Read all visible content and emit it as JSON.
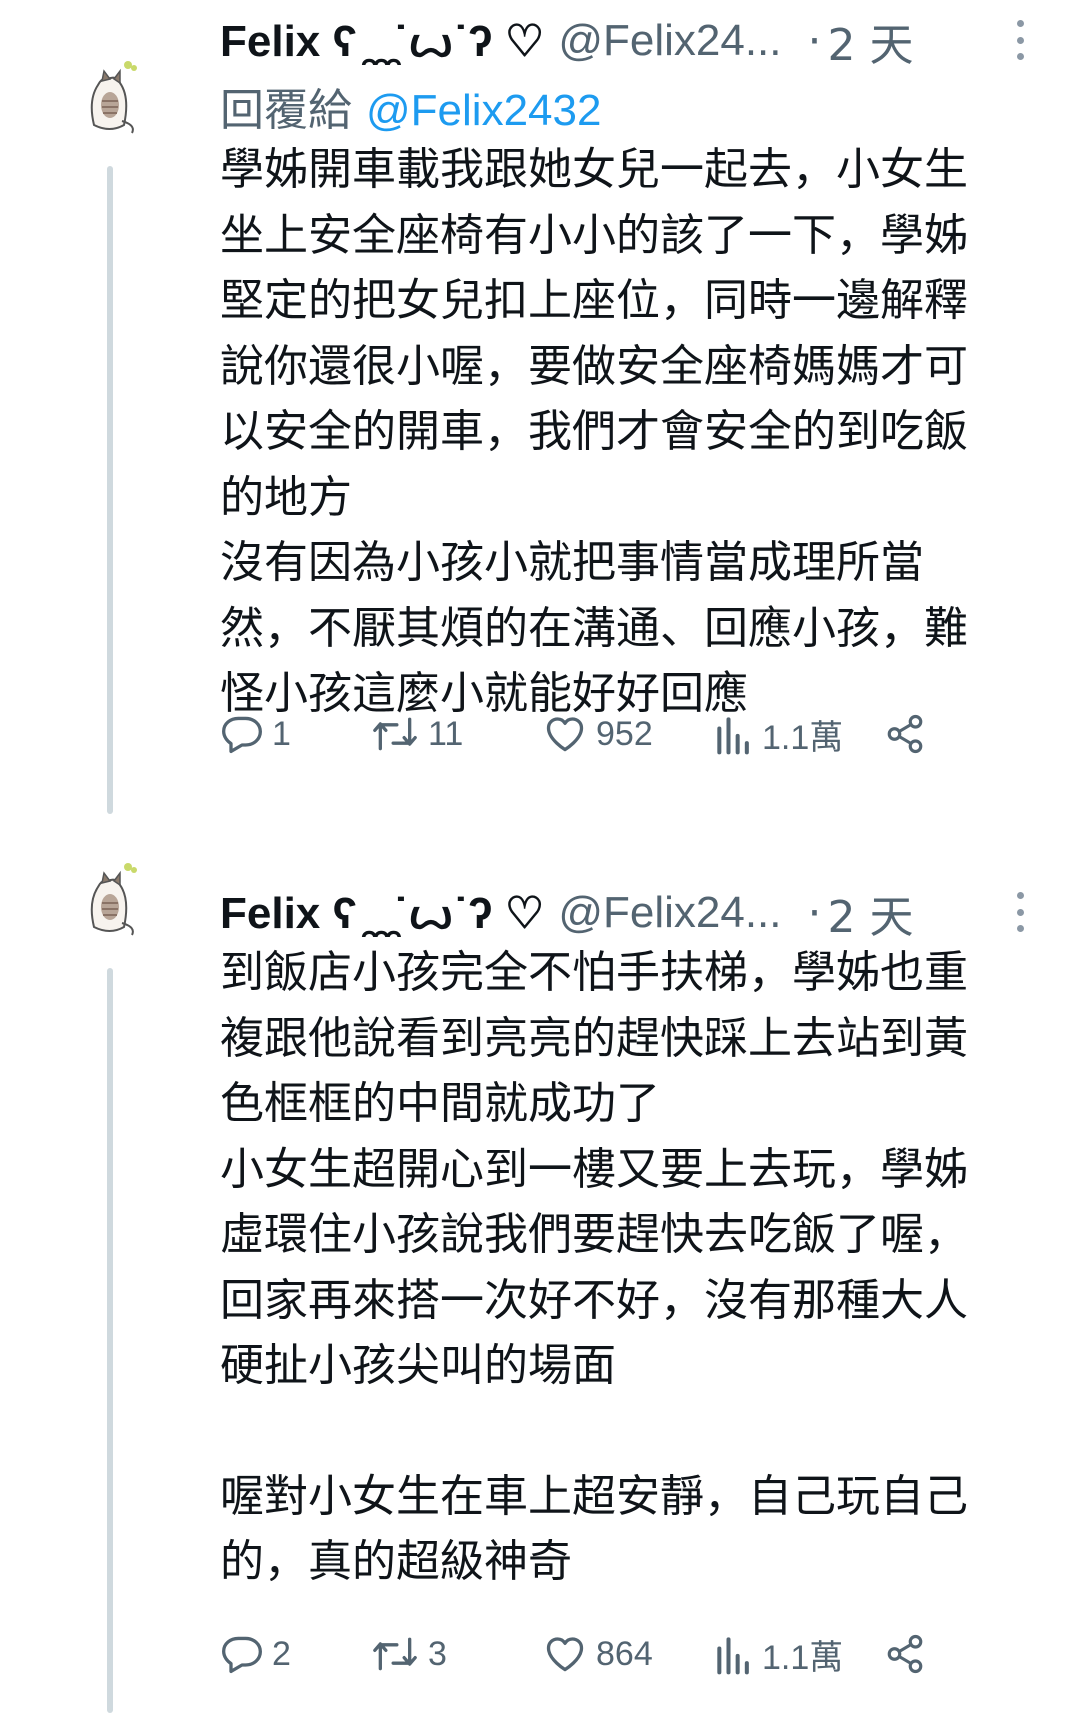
{
  "tweets": [
    {
      "name": "Felix ʕ ̯ ̯ ̯˙ꙍ˙ʔ ♡",
      "handle": "@Felix24...",
      "time_sep": "·",
      "time": "2 天",
      "reply_prefix": "回覆給",
      "reply_mention": "@Felix2432",
      "paragraphs": [
        "學姊開車載我跟她女兒一起去，小女生坐上安全座椅有小小的該了一下，學姊堅定的把女兒扣上座位，同時一邊解釋說你還很小喔，要做安全座椅媽媽才可以安全的開車，我們才會安全的到吃飯的地方",
        "沒有因為小孩小就把事情當成理所當然，不厭其煩的在溝通、回應小孩，難怪小孩這麼小就能好好回應"
      ],
      "actions": {
        "replies": "1",
        "retweets": "11",
        "likes": "952",
        "views": "1.1萬"
      }
    },
    {
      "name": "Felix ʕ ̯ ̯ ̯˙ꙍ˙ʔ ♡",
      "handle": "@Felix24...",
      "time_sep": "·",
      "time": "2 天",
      "paragraphs": [
        "到飯店小孩完全不怕手扶梯，學姊也重複跟他說看到亮亮的趕快踩上去站到黃色框框的中間就成功了",
        "小女生超開心到一樓又要上去玩，學姊虛環住小孩說我們要趕快去吃飯了喔，回家再來搭一次好不好，沒有那種大人硬扯小孩尖叫的場面",
        "",
        "喔對小女生在車上超安靜，自己玩自己的，真的超級神奇"
      ],
      "actions": {
        "replies": "2",
        "retweets": "3",
        "likes": "864",
        "views": "1.1萬"
      }
    }
  ]
}
